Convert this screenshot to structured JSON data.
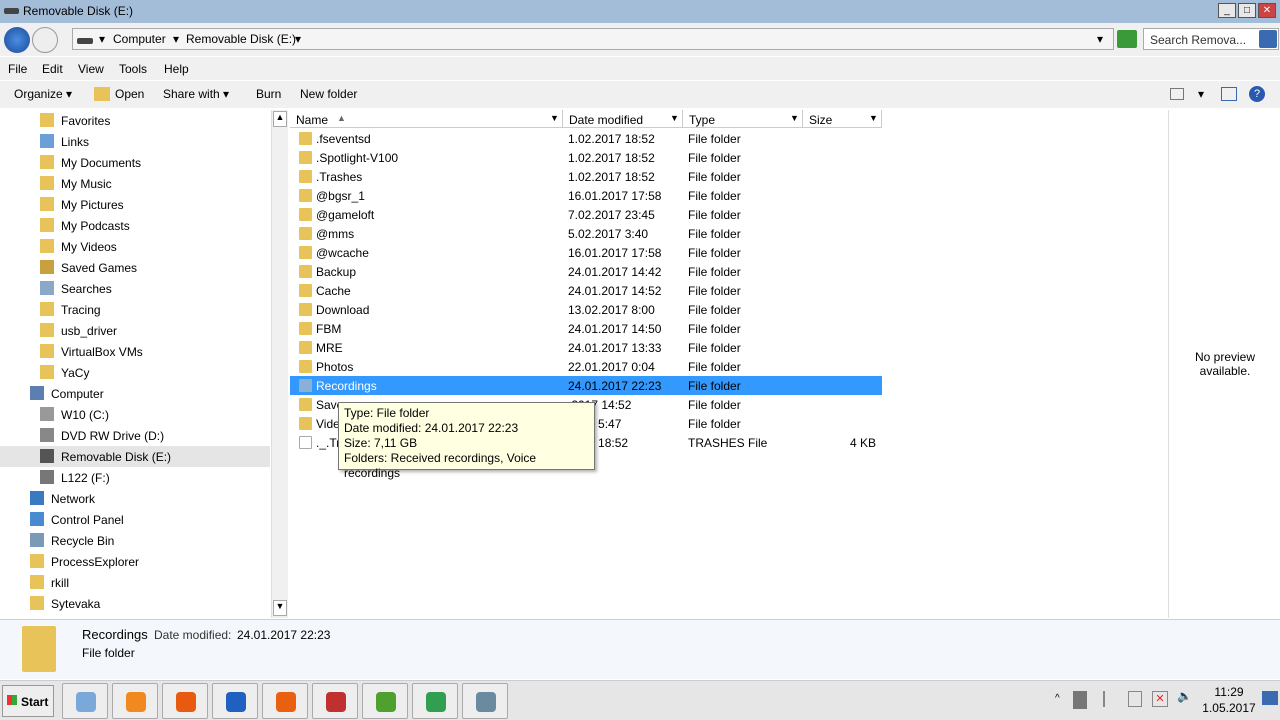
{
  "window": {
    "title": "Removable Disk (E:)",
    "min": "_",
    "max": "□",
    "close": "✕"
  },
  "address": {
    "crumbs": [
      "Computer",
      "Removable Disk (E:)"
    ],
    "search_placeholder": "Search Remova..."
  },
  "menu": [
    "File",
    "Edit",
    "View",
    "Tools",
    "Help"
  ],
  "toolbar": {
    "organize": "Organize ▾",
    "open": "Open",
    "share": "Share with ▾",
    "burn": "Burn",
    "new_folder": "New folder"
  },
  "nav": [
    {
      "label": "Favorites",
      "indent": 1,
      "color": "#e8c35a"
    },
    {
      "label": "Links",
      "indent": 1,
      "color": "#6a9fd8"
    },
    {
      "label": "My Documents",
      "indent": 1,
      "color": "#e8c35a"
    },
    {
      "label": "My Music",
      "indent": 1,
      "color": "#e8c35a"
    },
    {
      "label": "My Pictures",
      "indent": 1,
      "color": "#e8c35a"
    },
    {
      "label": "My Podcasts",
      "indent": 1,
      "color": "#e8c35a"
    },
    {
      "label": "My Videos",
      "indent": 1,
      "color": "#e8c35a"
    },
    {
      "label": "Saved Games",
      "indent": 1,
      "color": "#c9a040"
    },
    {
      "label": "Searches",
      "indent": 1,
      "color": "#8aa8c8"
    },
    {
      "label": "Tracing",
      "indent": 1,
      "color": "#e8c35a"
    },
    {
      "label": "usb_driver",
      "indent": 1,
      "color": "#e8c35a"
    },
    {
      "label": "VirtualBox VMs",
      "indent": 1,
      "color": "#e8c35a"
    },
    {
      "label": "YaCy",
      "indent": 1,
      "color": "#e8c35a"
    },
    {
      "label": "Computer",
      "indent": 0,
      "color": "#5a7fb0"
    },
    {
      "label": "W10 (C:)",
      "indent": 1,
      "color": "#999"
    },
    {
      "label": "DVD RW Drive (D:)",
      "indent": 1,
      "color": "#888"
    },
    {
      "label": "Removable Disk (E:)",
      "indent": 1,
      "color": "#555",
      "selected": true
    },
    {
      "label": "L122 (F:)",
      "indent": 1,
      "color": "#777"
    },
    {
      "label": "Network",
      "indent": 0,
      "color": "#3a7ac0"
    },
    {
      "label": "Control Panel",
      "indent": 0,
      "color": "#4a8ad0"
    },
    {
      "label": "Recycle Bin",
      "indent": 0,
      "color": "#7a9ab8"
    },
    {
      "label": "ProcessExplorer",
      "indent": 0,
      "color": "#e8c35a"
    },
    {
      "label": "rkill",
      "indent": 0,
      "color": "#e8c35a"
    },
    {
      "label": "Sytevaka",
      "indent": 0,
      "color": "#e8c35a"
    }
  ],
  "columns": {
    "name": "Name",
    "date": "Date modified",
    "type": "Type",
    "size": "Size"
  },
  "files": [
    {
      "name": ".fseventsd",
      "date": "1.02.2017 18:52",
      "type": "File folder",
      "size": ""
    },
    {
      "name": ".Spotlight-V100",
      "date": "1.02.2017 18:52",
      "type": "File folder",
      "size": ""
    },
    {
      "name": ".Trashes",
      "date": "1.02.2017 18:52",
      "type": "File folder",
      "size": ""
    },
    {
      "name": "@bgsr_1",
      "date": "16.01.2017 17:58",
      "type": "File folder",
      "size": ""
    },
    {
      "name": "@gameloft",
      "date": "7.02.2017 23:45",
      "type": "File folder",
      "size": ""
    },
    {
      "name": "@mms",
      "date": "5.02.2017 3:40",
      "type": "File folder",
      "size": ""
    },
    {
      "name": "@wcache",
      "date": "16.01.2017 17:58",
      "type": "File folder",
      "size": ""
    },
    {
      "name": "Backup",
      "date": "24.01.2017 14:42",
      "type": "File folder",
      "size": ""
    },
    {
      "name": "Cache",
      "date": "24.01.2017 14:52",
      "type": "File folder",
      "size": ""
    },
    {
      "name": "Download",
      "date": "13.02.2017 8:00",
      "type": "File folder",
      "size": ""
    },
    {
      "name": "FBM",
      "date": "24.01.2017 14:50",
      "type": "File folder",
      "size": ""
    },
    {
      "name": "MRE",
      "date": "24.01.2017 13:33",
      "type": "File folder",
      "size": ""
    },
    {
      "name": "Photos",
      "date": "22.01.2017 0:04",
      "type": "File folder",
      "size": ""
    },
    {
      "name": "Recordings",
      "date": "24.01.2017 22:23",
      "type": "File folder",
      "size": "",
      "selected": true
    },
    {
      "name": "Save",
      "date": ".2017 14:52",
      "type": "File folder",
      "size": ""
    },
    {
      "name": "Vide",
      "date": "2017 5:47",
      "type": "File folder",
      "size": ""
    },
    {
      "name": "._.Tr",
      "date": "2017 18:52",
      "type": "TRASHES File",
      "size": "4 KB",
      "file": true
    }
  ],
  "tooltip": [
    "Type: File folder",
    "Date modified: 24.01.2017 22:23",
    "Size: 7,11 GB",
    "Folders: Received recordings, Voice recordings"
  ],
  "preview": "No preview available.",
  "details": {
    "name": "Recordings",
    "date_label": "Date modified:",
    "date": "24.01.2017 22:23",
    "type": "File folder"
  },
  "taskbar": {
    "start": "Start",
    "apps": [
      "#7aa8d8",
      "#f08a20",
      "#e85a10",
      "#2060c0",
      "#e86010",
      "#c03030",
      "#50a030",
      "#30a050",
      "#6a8aa0"
    ],
    "time": "11:29",
    "date": "1.05.2017"
  }
}
